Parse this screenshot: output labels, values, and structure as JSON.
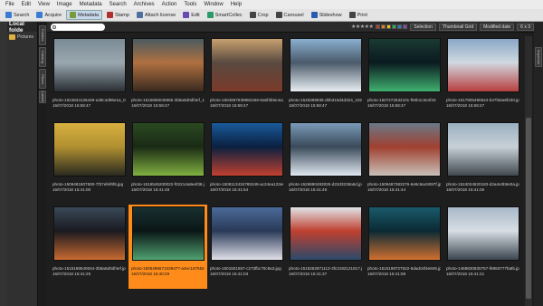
{
  "menu": [
    "File",
    "Edit",
    "View",
    "Image",
    "Metadata",
    "Search",
    "Archives",
    "Action",
    "Tools",
    "Window",
    "Help"
  ],
  "toolbar": [
    {
      "label": "Search",
      "icon": "search-icon",
      "color": "#3a7bd5"
    },
    {
      "label": "Acquire",
      "icon": "acquire-icon",
      "color": "#3a7bd5"
    },
    {
      "label": "Metadata",
      "icon": "metadata-icon",
      "color": "#7a9a3a",
      "dropdown": true
    },
    {
      "label": "Stamp",
      "icon": "stamp-icon",
      "color": "#b03030"
    },
    {
      "label": "Attach license",
      "icon": "license-icon",
      "color": "#5070a0"
    },
    {
      "label": "Edit",
      "icon": "edit-icon",
      "color": "#6a4ab0"
    },
    {
      "label": "SmartCollec",
      "icon": "smart-collection-icon",
      "color": "#2a9a6a"
    },
    {
      "label": "Crop",
      "icon": "crop-icon",
      "color": "#444444"
    },
    {
      "label": "Carousel",
      "icon": "carousel-icon",
      "color": "#444444"
    },
    {
      "label": "Slideshow",
      "icon": "slideshow-icon",
      "color": "#2a5ab0"
    },
    {
      "label": "Print",
      "icon": "print-icon",
      "color": "#444444"
    }
  ],
  "left_panel": {
    "title": "Local folde",
    "folder": "Pictures"
  },
  "left_tabs": [
    "Folders",
    "Catalog",
    "Filters",
    "Labels"
  ],
  "right_tabs": [
    "Inspector"
  ],
  "filter_bar": {
    "search_placeholder": "",
    "stars": "★★★★★",
    "swatches": [
      "#c0392b",
      "#e67e22",
      "#f1c40f",
      "#27ae60",
      "#2980b9",
      "#8e44ad"
    ],
    "selection_label": "Selection",
    "view_label": "Thumbnail Grid",
    "sort_label": "Modified date",
    "grid_label": "6 x 3"
  },
  "thumbnails": [
    {
      "name": "photo-1524634126449-a38c4d86e1a_0024",
      "date": "16/07/2018 15:58:47",
      "colors": [
        "#7a8a95",
        "#2a2f35",
        "#9aa8b0"
      ],
      "selected": false
    },
    {
      "name": "photo-1515666045955-3b8a5d0df4ef_1024",
      "date": "16/07/2018 15:58:47",
      "colors": [
        "#4a5a60",
        "#3a2a20",
        "#b07040"
      ],
      "selected": false
    },
    {
      "name": "photo-1504697639882256-6a6f3b5e4a24",
      "date": "16/07/2018 15:58:47",
      "colors": [
        "#c8a070",
        "#7a3a2a",
        "#5a4a40"
      ],
      "selected": false
    },
    {
      "name": "photo-1526398935-d0b315d4d324_1024",
      "date": "16/07/2018 15:58:47",
      "colors": [
        "#8ab0d0",
        "#e8eef2",
        "#4a5a6a"
      ],
      "selected": false
    },
    {
      "name": "photo-1507272532101-f60b1c3e4f43",
      "date": "16/07/2018 15:58:47",
      "colors": [
        "#1a3a30",
        "#40b070",
        "#0a1a20"
      ],
      "selected": false
    },
    {
      "name": "photo-1517905490624-b27fa5a6f230.jpg",
      "date": "16/07/2018 15:58:47",
      "colors": [
        "#8aa8c8",
        "#b84040",
        "#d0d8e0"
      ],
      "selected": false
    },
    {
      "name": "photo-1509481807500-7f37efef6f6.jpg",
      "date": "16/07/2018 15:41:00",
      "colors": [
        "#d8b040",
        "#2a2a20",
        "#b09030"
      ],
      "selected": false
    },
    {
      "name": "photo-1516545200022-f02214a8eef38.jpg",
      "date": "16/07/2018 15:41:48",
      "colors": [
        "#2a4a20",
        "#80b040",
        "#1a2a15"
      ],
      "selected": false
    },
    {
      "name": "photo-1508113434785349-ac24ea123e0.jpg",
      "date": "16/07/2018 15:41:54",
      "colors": [
        "#1a5a9a",
        "#c04030",
        "#0a2040"
      ],
      "selected": false
    },
    {
      "name": "photo-1526890493025-d22d3238a5d.jpg",
      "date": "16/07/2018 15:41:49",
      "colors": [
        "#7a9ab8",
        "#e0e8f0",
        "#3a4a5a"
      ],
      "selected": false
    },
    {
      "name": "photo-1509487383276-6e8c6ac9097f.jpg",
      "date": "16/07/2018 15:41:44",
      "colors": [
        "#6a7a88",
        "#c8c0b8",
        "#a04030"
      ],
      "selected": false
    },
    {
      "name": "photo-1524024820183-d2a4e3b9e0a.jpg",
      "date": "16/07/2018 15:41:05",
      "colors": [
        "#9ab0c0",
        "#404850",
        "#c8d0d8"
      ],
      "selected": false
    },
    {
      "name": "photo-1515169540044-3b8a5d0df4ef.jpg",
      "date": "16/07/2018 15:41:25",
      "colors": [
        "#3a4a58",
        "#c86a30",
        "#1a1a20"
      ],
      "selected": false
    },
    {
      "name": "photo-1505496671029477-a4ec1675b6e.jpg",
      "date": "16/07/2018 15:40:29",
      "colors": [
        "#1a3030",
        "#50a070",
        "#0a1515"
      ],
      "selected": false
    },
    {
      "name": "photo-1501501557-c273fbc70c8a3.jpg",
      "date": "16/07/2018 15:41:03",
      "colors": [
        "#4a6a98",
        "#e0e0e8",
        "#2a3a58"
      ],
      "selected": false
    },
    {
      "name": "photo-1516262871113-3fc2182121817.jpg",
      "date": "16/07/2018 15:41:37",
      "colors": [
        "#e0e4e8",
        "#2a4a6a",
        "#c04030"
      ],
      "selected": false
    },
    {
      "name": "photo-1515198727622-6dadc5f4e845.jpg",
      "date": "16/07/2018 15:41:58",
      "colors": [
        "#1a5a6a",
        "#d07030",
        "#0a2a35"
      ],
      "selected": false
    },
    {
      "name": "photo-1468830830757-f6950777fa6b.jpg",
      "date": "16/07/2018 15:41:21",
      "colors": [
        "#a8b8c8",
        "#3a4550",
        "#d8dee4"
      ],
      "selected": false
    }
  ],
  "selected_index": 13
}
